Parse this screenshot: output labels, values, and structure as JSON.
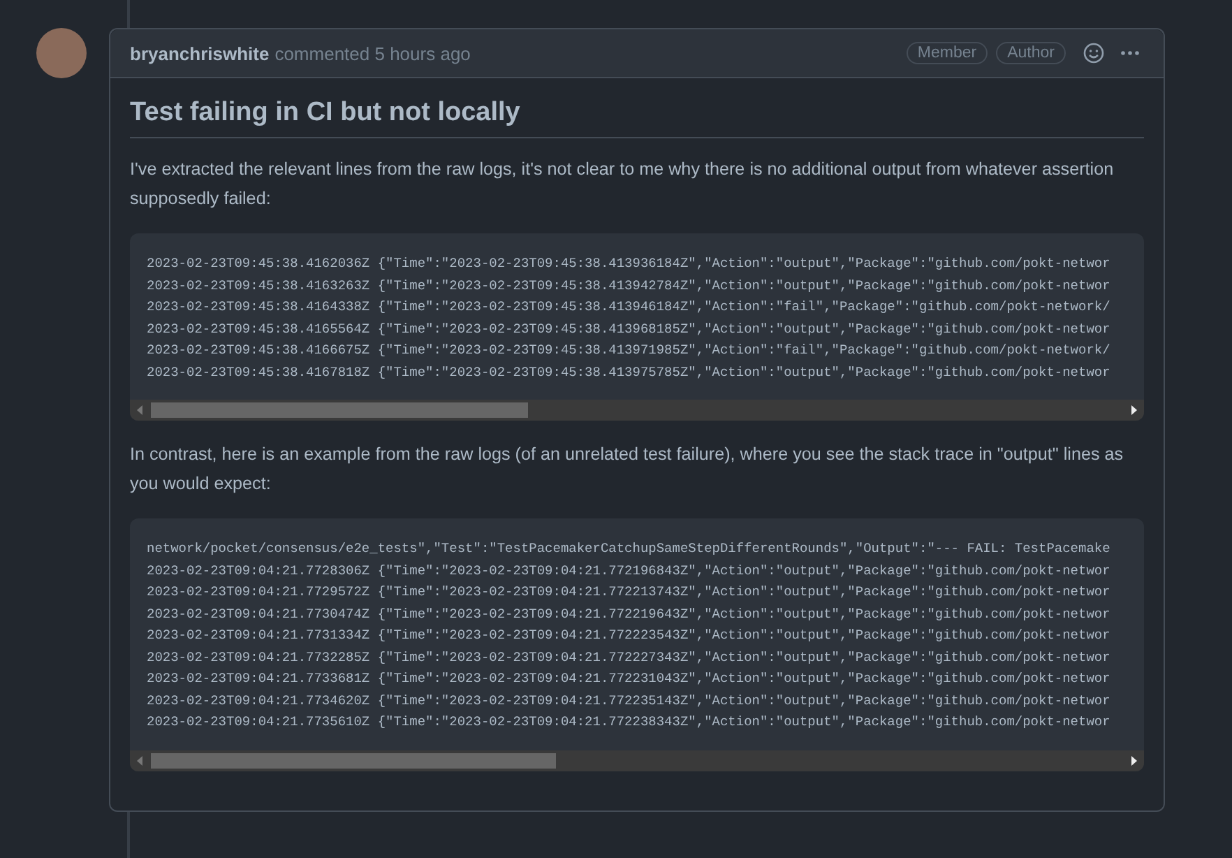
{
  "comment": {
    "author": "bryanchriswhite",
    "meta": "commented 5 hours ago",
    "badges": [
      "Member",
      "Author"
    ],
    "title": "Test failing in CI but not locally",
    "blocks": [
      {
        "kind": "paragraph",
        "text": "I've extracted the relevant lines from the raw logs, it's not clear to me why there is no additional output from whatever assertion supposedly failed:"
      },
      {
        "kind": "code",
        "lines": [
          "2023-02-23T09:45:38.4162036Z {\"Time\":\"2023-02-23T09:45:38.413936184Z\",\"Action\":\"output\",\"Package\":\"github.com/pokt-networ",
          "2023-02-23T09:45:38.4163263Z {\"Time\":\"2023-02-23T09:45:38.413942784Z\",\"Action\":\"output\",\"Package\":\"github.com/pokt-networ",
          "2023-02-23T09:45:38.4164338Z {\"Time\":\"2023-02-23T09:45:38.413946184Z\",\"Action\":\"fail\",\"Package\":\"github.com/pokt-network/",
          "2023-02-23T09:45:38.4165564Z {\"Time\":\"2023-02-23T09:45:38.413968185Z\",\"Action\":\"output\",\"Package\":\"github.com/pokt-networ",
          "2023-02-23T09:45:38.4166675Z {\"Time\":\"2023-02-23T09:45:38.413971985Z\",\"Action\":\"fail\",\"Package\":\"github.com/pokt-network/",
          "2023-02-23T09:45:38.4167818Z {\"Time\":\"2023-02-23T09:45:38.413975785Z\",\"Action\":\"output\",\"Package\":\"github.com/pokt-networ"
        ]
      },
      {
        "kind": "paragraph",
        "text": "In contrast, here is an example from the raw logs (of an unrelated test failure), where you see the stack trace in \"output\" lines as you would expect:"
      },
      {
        "kind": "code",
        "lines": [
          "network/pocket/consensus/e2e_tests\",\"Test\":\"TestPacemakerCatchupSameStepDifferentRounds\",\"Output\":\"--- FAIL: TestPacemake",
          "2023-02-23T09:04:21.7728306Z {\"Time\":\"2023-02-23T09:04:21.772196843Z\",\"Action\":\"output\",\"Package\":\"github.com/pokt-networ",
          "2023-02-23T09:04:21.7729572Z {\"Time\":\"2023-02-23T09:04:21.772213743Z\",\"Action\":\"output\",\"Package\":\"github.com/pokt-networ",
          "2023-02-23T09:04:21.7730474Z {\"Time\":\"2023-02-23T09:04:21.772219643Z\",\"Action\":\"output\",\"Package\":\"github.com/pokt-networ",
          "2023-02-23T09:04:21.7731334Z {\"Time\":\"2023-02-23T09:04:21.772223543Z\",\"Action\":\"output\",\"Package\":\"github.com/pokt-networ",
          "2023-02-23T09:04:21.7732285Z {\"Time\":\"2023-02-23T09:04:21.772227343Z\",\"Action\":\"output\",\"Package\":\"github.com/pokt-networ",
          "2023-02-23T09:04:21.7733681Z {\"Time\":\"2023-02-23T09:04:21.772231043Z\",\"Action\":\"output\",\"Package\":\"github.com/pokt-networ",
          "2023-02-23T09:04:21.7734620Z {\"Time\":\"2023-02-23T09:04:21.772235143Z\",\"Action\":\"output\",\"Package\":\"github.com/pokt-networ",
          "2023-02-23T09:04:21.7735610Z {\"Time\":\"2023-02-23T09:04:21.772238343Z\",\"Action\":\"output\",\"Package\":\"github.com/pokt-networ"
        ]
      }
    ]
  }
}
